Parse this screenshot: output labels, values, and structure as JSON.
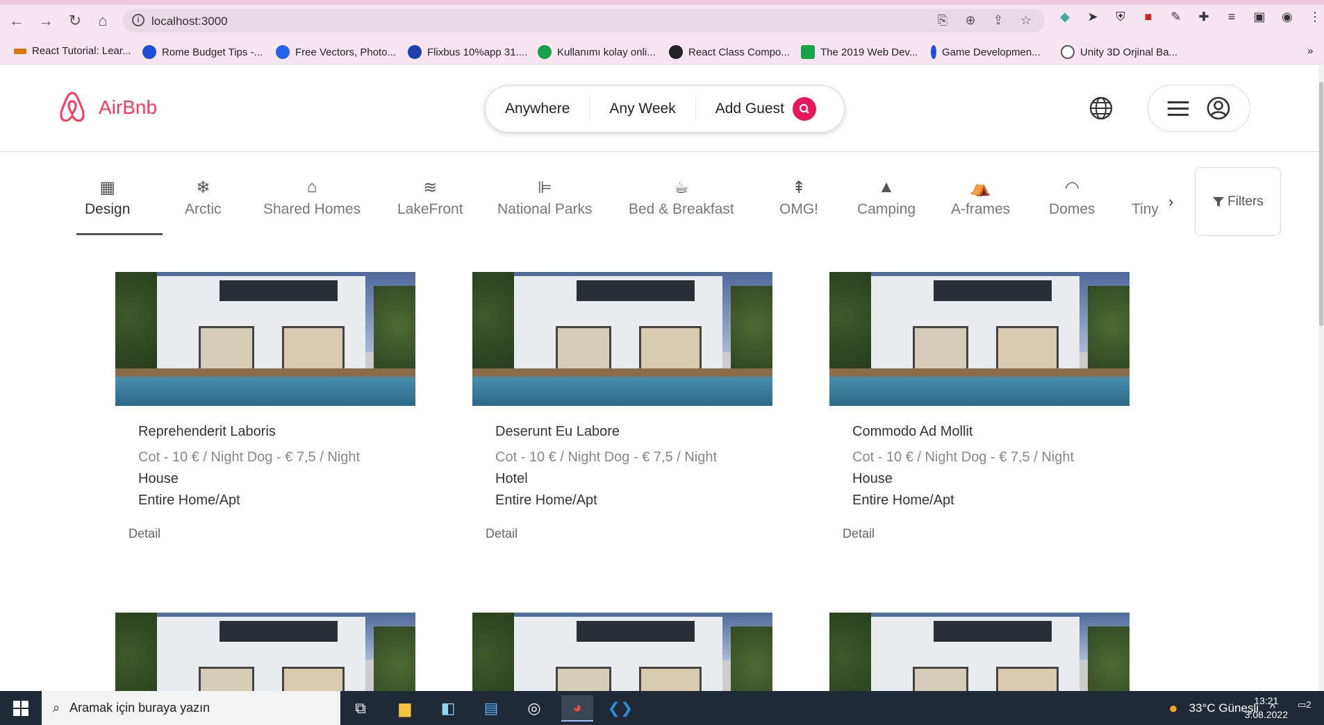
{
  "browser": {
    "url": "localhost:3000",
    "bookmarks": [
      {
        "label": "React Tutorial: Lear...",
        "color": "#d97706"
      },
      {
        "label": "Rome Budget Tips -...",
        "color": "#1d4ed8"
      },
      {
        "label": "Free Vectors, Photo...",
        "color": "#2563eb"
      },
      {
        "label": "Flixbus 10%app 31....",
        "color": "#1e40af"
      },
      {
        "label": "Kullanımı kolay onli...",
        "color": "#16a34a"
      },
      {
        "label": "React Class Compo...",
        "color": "#222222"
      },
      {
        "label": "The 2019 Web Dev...",
        "color": "#16a34a"
      },
      {
        "label": "Game Developmen...",
        "color": "#1d4ed8"
      },
      {
        "label": "Unity 3D Orjinal Ba...",
        "color": "#555555"
      }
    ],
    "bookmarks_more": "»"
  },
  "header": {
    "logo_text": "AirBnb",
    "brand_color": "#ff385c",
    "search": {
      "anywhere": "Anywhere",
      "any_week": "Any Week",
      "add_guest": "Add Guest"
    }
  },
  "categories": [
    {
      "label": "Design",
      "icon": "building-icon",
      "active": true
    },
    {
      "label": "Arctic",
      "icon": "snowflake-icon"
    },
    {
      "label": "Shared Homes",
      "icon": "home-icon"
    },
    {
      "label": "LakeFront",
      "icon": "water-icon"
    },
    {
      "label": "National Parks",
      "icon": "slide-icon"
    },
    {
      "label": "Bed & Breakfast",
      "icon": "mug-icon"
    },
    {
      "label": "OMG!",
      "icon": "tower-icon"
    },
    {
      "label": "Camping",
      "icon": "tent-icon"
    },
    {
      "label": "A-frames",
      "icon": "aframe-icon"
    },
    {
      "label": "Domes",
      "icon": "dome-icon"
    },
    {
      "label": "Tiny",
      "icon": "tiny-icon"
    }
  ],
  "filters_label": "Filters",
  "listings": [
    {
      "title": "Reprehenderit Laboris",
      "price": "Cot - 10 € / Night Dog - € 7,5 / Night",
      "property_type": "House",
      "room_type": "Entire Home/Apt",
      "detail": "Detail"
    },
    {
      "title": "Deserunt Eu Labore",
      "price": "Cot - 10 € / Night Dog - € 7,5 / Night",
      "property_type": "Hotel",
      "room_type": "Entire Home/Apt",
      "detail": "Detail"
    },
    {
      "title": "Commodo Ad Mollit",
      "price": "Cot - 10 € / Night Dog - € 7,5 / Night",
      "property_type": "House",
      "room_type": "Entire Home/Apt",
      "detail": "Detail"
    }
  ],
  "taskbar": {
    "search_placeholder": "Aramak için buraya yazın",
    "weather": "33°C  Güneşli",
    "time": "13:21",
    "date": "3.08.2022",
    "notifications": "2"
  }
}
